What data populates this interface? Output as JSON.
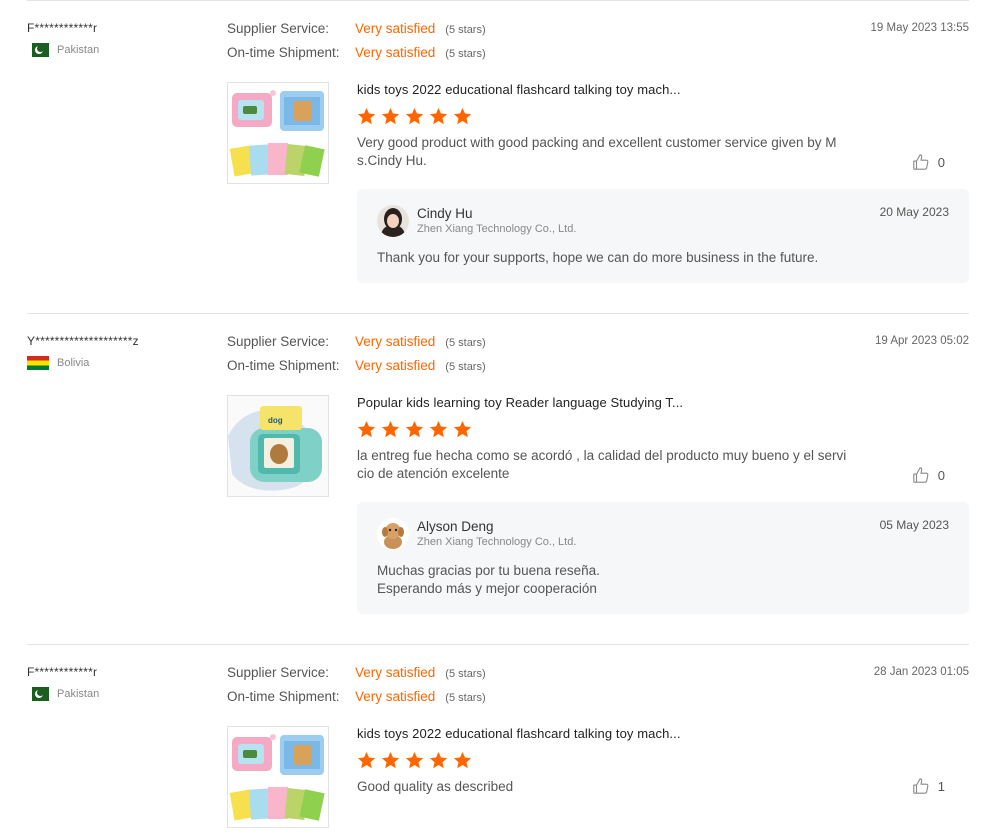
{
  "reviews": [
    {
      "buyer": "F************r",
      "country": "Pakistan",
      "flag": "flag-pakistan",
      "ratings": [
        {
          "label": "Supplier Service:",
          "value": "Very satisfied",
          "stars": "(5 stars)"
        },
        {
          "label": "On-time Shipment:",
          "value": "Very satisfied",
          "stars": "(5 stars)"
        }
      ],
      "date": "19 May 2023 13:55",
      "product_title": "kids toys 2022 educational flashcard talking toy mach...",
      "star_count": 5,
      "text": "Very good product with good packing and excellent customer service given by M s.Cindy Hu.",
      "helpful_count": "0",
      "reply": {
        "name": "Cindy Hu",
        "company": "Zhen Xiang Technology Co., Ltd.",
        "date": "20 May 2023",
        "text": "Thank you for your supports, hope we can do more business in the future."
      }
    },
    {
      "buyer": "Y********************z",
      "country": "Bolivia",
      "flag": "flag-bolivia",
      "ratings": [
        {
          "label": "Supplier Service:",
          "value": "Very satisfied",
          "stars": "(5 stars)"
        },
        {
          "label": "On-time Shipment:",
          "value": "Very satisfied",
          "stars": "(5 stars)"
        }
      ],
      "date": "19 Apr 2023 05:02",
      "product_title": "Popular kids learning toy Reader language Studying T...",
      "star_count": 5,
      "text": "la entreg fue hecha como se acordó , la calidad del producto muy bueno y el servi cio de atención excelente",
      "helpful_count": "0",
      "reply": {
        "name": "Alyson Deng",
        "company": "Zhen Xiang Technology Co., Ltd.",
        "date": "05 May 2023",
        "text_line1": "Muchas gracias por tu buena reseña.",
        "text_line2": "Esperando más y mejor cooperación"
      }
    },
    {
      "buyer": "F************r",
      "country": "Pakistan",
      "flag": "flag-pakistan",
      "ratings": [
        {
          "label": "Supplier Service:",
          "value": "Very satisfied",
          "stars": "(5 stars)"
        },
        {
          "label": "On-time Shipment:",
          "value": "Very satisfied",
          "stars": "(5 stars)"
        }
      ],
      "date": "28 Jan 2023 01:05",
      "product_title": "kids toys 2022 educational flashcard talking toy mach...",
      "star_count": 5,
      "text": "Good quality as described",
      "helpful_count": "1"
    }
  ],
  "product_images": {
    "flashcard_card_word": "dog"
  },
  "colors": {
    "accent": "#ff6600",
    "reply_bg": "#f6f7f8",
    "divider": "#e4e4e4"
  }
}
